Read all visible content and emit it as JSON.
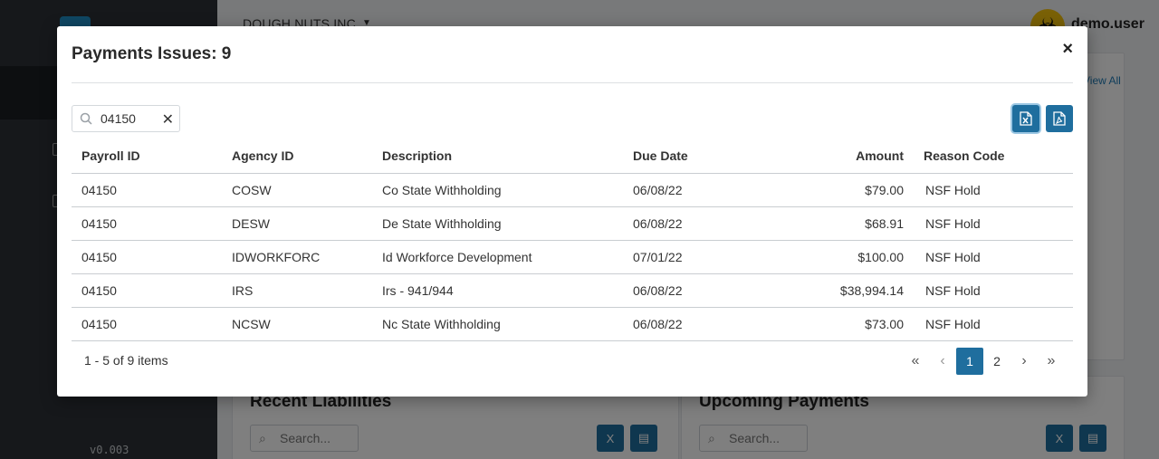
{
  "app": {
    "company": "DOUGH NUTS INC",
    "user_name": "demo.user",
    "version": "v0.003",
    "view_all_label": "View All"
  },
  "background_cards": {
    "recent_liabilities": {
      "title": "Recent Liabilities",
      "search_placeholder": "Search..."
    },
    "upcoming_payments": {
      "title": "Upcoming Payments",
      "search_placeholder": "Search..."
    }
  },
  "modal": {
    "title": "Payments Issues: 9",
    "close_label": "×",
    "search": {
      "value": "04150",
      "clear_label": "✕"
    },
    "columns": {
      "payroll_id": "Payroll ID",
      "agency_id": "Agency ID",
      "description": "Description",
      "due_date": "Due Date",
      "amount": "Amount",
      "reason_code": "Reason Code"
    },
    "rows": [
      {
        "payroll_id": "04150",
        "agency_id": "COSW",
        "description": "Co State Withholding",
        "due_date": "06/08/22",
        "amount": "$79.00",
        "reason_code": "NSF Hold"
      },
      {
        "payroll_id": "04150",
        "agency_id": "DESW",
        "description": "De State Withholding",
        "due_date": "06/08/22",
        "amount": "$68.91",
        "reason_code": "NSF Hold"
      },
      {
        "payroll_id": "04150",
        "agency_id": "IDWORKFORC",
        "description": "Id Workforce Development",
        "due_date": "07/01/22",
        "amount": "$100.00",
        "reason_code": "NSF Hold"
      },
      {
        "payroll_id": "04150",
        "agency_id": "IRS",
        "description": "Irs - 941/944",
        "due_date": "06/08/22",
        "amount": "$38,994.14",
        "reason_code": "NSF Hold"
      },
      {
        "payroll_id": "04150",
        "agency_id": "NCSW",
        "description": "Nc State Withholding",
        "due_date": "06/08/22",
        "amount": "$73.00",
        "reason_code": "NSF Hold"
      }
    ],
    "pager": {
      "info": "1 - 5 of 9 items",
      "first": "«",
      "prev": "‹",
      "pages": [
        "1",
        "2"
      ],
      "current_page": "1",
      "next": "›",
      "last": "»"
    }
  },
  "colors": {
    "primary": "#1f6e9e",
    "sidebar": "#2c3136",
    "overlay": "rgba(0,0,0,0.5)"
  }
}
